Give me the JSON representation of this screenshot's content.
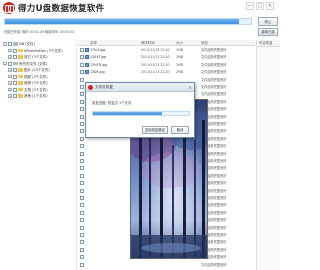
{
  "app": {
    "title": "得力U盘数据恢复软件"
  },
  "window_buttons": [
    "—",
    "□",
    "✕"
  ],
  "scan": {
    "progress_fraction": 0.95,
    "stop_label": "停止",
    "status_text": "扫描已完成! 耗时 00:01:49 耗用时间: 00:00:54",
    "rescan_label": "重新扫描"
  },
  "tree": [
    {
      "label": "DB (文件)",
      "level": 0,
      "expanded": true,
      "folder": "gray"
    },
    {
      "label": "ePosinfoMan (3个文件)",
      "level": 1,
      "expanded": false,
      "folder": "yellow"
    },
    {
      "label": "其它 (3个文件)",
      "level": 1,
      "expanded": false,
      "folder": "yellow"
    },
    {
      "label": "丢失的文件 (文件)",
      "level": 0,
      "expanded": true,
      "folder": "gray"
    },
    {
      "label": "图片 (23个文件)",
      "level": 1,
      "expanded": false,
      "folder": "yellow"
    },
    {
      "label": "视频 (3个文件)",
      "level": 1,
      "expanded": false,
      "folder": "yellow"
    },
    {
      "label": "音频 (3个文件)",
      "level": 1,
      "expanded": false,
      "folder": "yellow"
    },
    {
      "label": "文档 (3个文件)",
      "level": 1,
      "expanded": false,
      "folder": "yellow"
    },
    {
      "label": "其他 (1个文件)",
      "level": 1,
      "expanded": false,
      "folder": "yellow"
    }
  ],
  "file_list": {
    "headers": {
      "name": "名称",
      "date": "修改时间",
      "size": "大小",
      "state": "状态"
    },
    "rows": [
      {
        "name": "13%4.jpg",
        "date": "2011/11/13 22:20",
        "size": "1MB",
        "state": "文件结构完整良好"
      },
      {
        "name": "13XXT.jpg",
        "date": "2011/11/13 22:20",
        "size": "2MB",
        "state": "文件结构完整良好"
      },
      {
        "name": "13%FR.jpg",
        "date": "2011/11/13 22:20",
        "size": "2MB",
        "state": "文件结构完整良好"
      },
      {
        "name": "13&R.jpg",
        "date": "2011/11/13 22:20",
        "size": "2MB",
        "state": "文件结构完整良好"
      },
      {
        "name": "",
        "date": "",
        "size": "",
        "state": "文件结构完整良好"
      },
      {
        "name": "",
        "date": "",
        "size": "",
        "state": "文件结构完整良好"
      },
      {
        "name": "",
        "date": "",
        "size": "",
        "state": "文件结构完整良好"
      },
      {
        "name": "",
        "date": "",
        "size": "",
        "state": "文件结构完整良好"
      },
      {
        "name": "",
        "date": "",
        "size": "",
        "state": "文件结构完整良好"
      },
      {
        "name": "",
        "date": "",
        "size": "",
        "state": "文件结构完整良好"
      },
      {
        "name": "",
        "date": "",
        "size": "",
        "state": "文件结构完整良好"
      },
      {
        "name": "",
        "date": "",
        "size": "",
        "state": "文件结构完整良好"
      },
      {
        "name": "",
        "date": "",
        "size": "",
        "state": "文件结构完整良好"
      },
      {
        "name": "",
        "date": "",
        "size": "",
        "state": "文件结构完整良好"
      },
      {
        "name": "",
        "date": "",
        "size": "",
        "state": "文件结构完整良好"
      },
      {
        "name": "",
        "date": "",
        "size": "",
        "state": "文件结构完整良好"
      },
      {
        "name": "",
        "date": "",
        "size": "",
        "state": "文件结构完整良好"
      },
      {
        "name": "",
        "date": "",
        "size": "",
        "state": "文件结构完整良好"
      },
      {
        "name": "",
        "date": "",
        "size": "",
        "state": "文件结构完整良好"
      },
      {
        "name": "",
        "date": "",
        "size": "",
        "state": "文件结构完整良好"
      },
      {
        "name": "",
        "date": "",
        "size": "",
        "state": "文件结构完整良好"
      },
      {
        "name": "",
        "date": "",
        "size": "",
        "state": "文件结构完整良好"
      },
      {
        "name": "",
        "date": "",
        "size": "",
        "state": "文件结构完整良好"
      },
      {
        "name": "",
        "date": "",
        "size": "",
        "state": "文件结构完整良好"
      },
      {
        "name": "",
        "date": "",
        "size": "",
        "state": "文件结构完整良好"
      },
      {
        "name": "",
        "date": "",
        "size": "",
        "state": "文件结构完整良好"
      },
      {
        "name": "",
        "date": "",
        "size": "",
        "state": "文件结构完整良好"
      },
      {
        "name": "",
        "date": "",
        "size": "",
        "state": "文件结构完整良好"
      },
      {
        "name": "",
        "date": "",
        "size": "",
        "state": "文件结构完整良好"
      },
      {
        "name": "",
        "date": "",
        "size": "",
        "state": "文件结构完整良好"
      }
    ]
  },
  "right_column": {
    "header": "可否恢复"
  },
  "dialog": {
    "title": "文件外恢复",
    "label": "恢复进度: 恢复达 1个文件",
    "progress_fraction": 0.72,
    "open_folder_label": "复制恢复路径",
    "cancel_label": "取消"
  },
  "colors": {
    "brand_red": "#d8221c",
    "progress_blue": "#3d8fdd"
  }
}
